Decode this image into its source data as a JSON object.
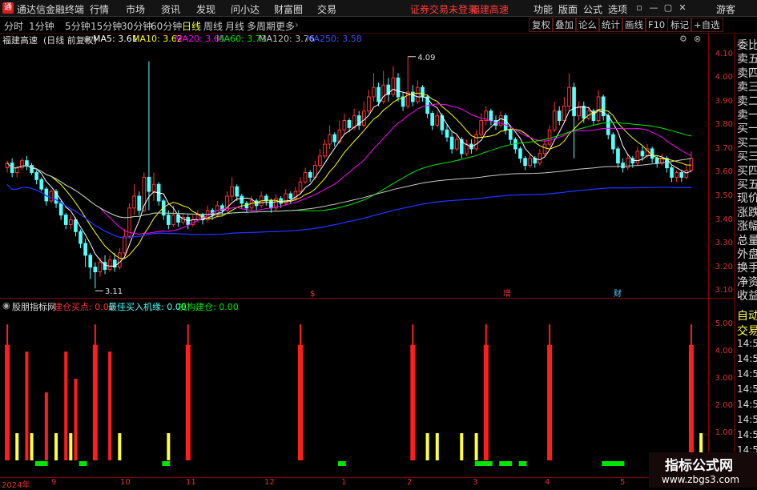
{
  "titlebar": {
    "app_name": "通达信金融终端",
    "menus": [
      "行情",
      "市场",
      "资讯",
      "发现",
      "问小达",
      "财富圈",
      "交易"
    ],
    "alert": "证券交易未登录",
    "alert_stock": "福建高速",
    "right_menus": [
      "功能",
      "版面",
      "公式",
      "选项"
    ],
    "user": "游客"
  },
  "periodbar": {
    "periods": [
      "分时",
      "1分钟",
      "5分钟",
      "15分钟",
      "30分钟",
      "60分钟",
      "日线",
      "周线",
      "月线",
      "多周期",
      "更多"
    ],
    "active": "日线",
    "tools": [
      "复权",
      "叠加",
      "论么",
      "统计",
      "画线",
      "F10",
      "标记",
      "+自选"
    ]
  },
  "infobar": {
    "stock": "福建高速",
    "mode": "(日线 前复权)",
    "ma5": "MA5: 3.61",
    "ma10": "MA10: 3.62",
    "ma20": "MA20: 3.65",
    "ma60": "MA60: 3.73",
    "ma120": "MA120: 3.76",
    "ma250": "MA250: 3.58"
  },
  "price_axis": [
    "4.10",
    "4.00",
    "3.90",
    "3.80",
    "3.70",
    "3.60",
    "3.50",
    "3.40",
    "3.30",
    "3.20",
    "3.10"
  ],
  "chart_marks": {
    "high": "4.09",
    "low": "3.11",
    "events": [
      "$",
      "增",
      "财"
    ]
  },
  "right_panel": [
    "委比",
    "卖五",
    "卖四",
    "卖三",
    "卖二",
    "卖一",
    "买一",
    "买二",
    "买三",
    "买四",
    "买五",
    "现价",
    "涨跌",
    "涨幅",
    "总量",
    "外盘",
    "换手",
    "净资",
    "收益"
  ],
  "right_panel_lower": [
    "自动",
    "交易",
    "14:56",
    "14:56",
    "14:56",
    "14:56",
    "14:56",
    "14:56",
    "14:56",
    "14:56"
  ],
  "indicator": {
    "name": "股朋指标网",
    "l1": "建仓买点: 0.00",
    "l2": "最佳买入机缘: 0.00",
    "l3": "机构建仓: 0.00",
    "axis": [
      "5.00",
      "4.00",
      "3.00",
      "2.00",
      "1.00"
    ]
  },
  "date_axis": [
    "2024年",
    "9",
    "10",
    "11",
    "12",
    "1",
    "2",
    "3",
    "4",
    "5"
  ],
  "watermark": {
    "title": "指标公式网",
    "url": "www.zbgs3.com"
  },
  "colors": {
    "up": "#ff3232",
    "down": "#54ffff",
    "ma5": "#ffffff",
    "ma10": "#ffff00",
    "ma20": "#ff00ff",
    "ma60": "#00e600",
    "ma120": "#c8c8c8",
    "ma250": "#1e32ff"
  },
  "chart_data": {
    "type": "candlestick",
    "ylim": [
      3.07,
      4.14
    ],
    "candles": [
      [
        3.62,
        3.64,
        3.6,
        3.65
      ],
      [
        3.64,
        3.6,
        3.58,
        3.66
      ],
      [
        3.6,
        3.62,
        3.58,
        3.63
      ],
      [
        3.62,
        3.65,
        3.61,
        3.66
      ],
      [
        3.65,
        3.63,
        3.61,
        3.67
      ],
      [
        3.63,
        3.6,
        3.59,
        3.64
      ],
      [
        3.6,
        3.57,
        3.55,
        3.61
      ],
      [
        3.57,
        3.53,
        3.52,
        3.58
      ],
      [
        3.53,
        3.48,
        3.46,
        3.54
      ],
      [
        3.48,
        3.52,
        3.47,
        3.53
      ],
      [
        3.52,
        3.47,
        3.45,
        3.53
      ],
      [
        3.47,
        3.42,
        3.4,
        3.48
      ],
      [
        3.42,
        3.38,
        3.36,
        3.43
      ],
      [
        3.38,
        3.4,
        3.36,
        3.42
      ],
      [
        3.4,
        3.35,
        3.33,
        3.41
      ],
      [
        3.35,
        3.3,
        3.28,
        3.36
      ],
      [
        3.3,
        3.25,
        3.2,
        3.32
      ],
      [
        3.25,
        3.2,
        3.15,
        3.26
      ],
      [
        3.2,
        3.18,
        3.11,
        3.22
      ],
      [
        3.18,
        3.22,
        3.16,
        3.24
      ],
      [
        3.22,
        3.19,
        3.17,
        3.25
      ],
      [
        3.19,
        3.23,
        3.18,
        3.25
      ],
      [
        3.23,
        3.2,
        3.18,
        3.26
      ],
      [
        3.2,
        3.26,
        3.19,
        3.28
      ],
      [
        3.26,
        3.33,
        3.25,
        3.36
      ],
      [
        3.33,
        3.45,
        3.32,
        3.47
      ],
      [
        3.45,
        3.5,
        3.42,
        3.55
      ],
      [
        3.5,
        3.44,
        3.42,
        3.52
      ],
      [
        3.44,
        3.58,
        3.43,
        3.6
      ],
      [
        3.58,
        3.52,
        3.44,
        4.07
      ],
      [
        3.52,
        3.55,
        3.48,
        3.6
      ],
      [
        3.55,
        3.48,
        3.46,
        3.56
      ],
      [
        3.48,
        3.42,
        3.4,
        3.49
      ],
      [
        3.42,
        3.38,
        3.36,
        3.44
      ],
      [
        3.38,
        3.42,
        3.37,
        3.46
      ],
      [
        3.42,
        3.39,
        3.37,
        3.44
      ],
      [
        3.39,
        3.41,
        3.38,
        3.43
      ],
      [
        3.41,
        3.38,
        3.36,
        3.42
      ],
      [
        3.38,
        3.4,
        3.37,
        3.42
      ],
      [
        3.4,
        3.42,
        3.39,
        3.44
      ],
      [
        3.42,
        3.4,
        3.38,
        3.43
      ],
      [
        3.4,
        3.44,
        3.39,
        3.46
      ],
      [
        3.44,
        3.42,
        3.4,
        3.45
      ],
      [
        3.42,
        3.46,
        3.41,
        3.48
      ],
      [
        3.46,
        3.44,
        3.42,
        3.47
      ],
      [
        3.44,
        3.5,
        3.43,
        3.52
      ],
      [
        3.5,
        3.54,
        3.48,
        3.58
      ],
      [
        3.54,
        3.5,
        3.48,
        3.55
      ],
      [
        3.5,
        3.47,
        3.45,
        3.51
      ],
      [
        3.47,
        3.45,
        3.43,
        3.48
      ],
      [
        3.45,
        3.48,
        3.44,
        3.5
      ],
      [
        3.48,
        3.46,
        3.44,
        3.49
      ],
      [
        3.46,
        3.5,
        3.45,
        3.52
      ],
      [
        3.5,
        3.48,
        3.46,
        3.51
      ],
      [
        3.48,
        3.45,
        3.43,
        3.49
      ],
      [
        3.45,
        3.49,
        3.44,
        3.51
      ],
      [
        3.49,
        3.47,
        3.45,
        3.5
      ],
      [
        3.47,
        3.51,
        3.46,
        3.53
      ],
      [
        3.51,
        3.49,
        3.47,
        3.52
      ],
      [
        3.49,
        3.52,
        3.48,
        3.54
      ],
      [
        3.52,
        3.56,
        3.51,
        3.58
      ],
      [
        3.56,
        3.6,
        3.55,
        3.62
      ],
      [
        3.6,
        3.58,
        3.56,
        3.61
      ],
      [
        3.58,
        3.63,
        3.57,
        3.65
      ],
      [
        3.63,
        3.67,
        3.62,
        3.7
      ],
      [
        3.67,
        3.72,
        3.66,
        3.74
      ],
      [
        3.72,
        3.76,
        3.7,
        3.8
      ],
      [
        3.76,
        3.73,
        3.71,
        3.77
      ],
      [
        3.73,
        3.78,
        3.72,
        3.82
      ],
      [
        3.78,
        3.82,
        3.76,
        3.85
      ],
      [
        3.82,
        3.79,
        3.77,
        3.83
      ],
      [
        3.79,
        3.84,
        3.78,
        3.87
      ],
      [
        3.84,
        3.8,
        3.78,
        3.86
      ],
      [
        3.8,
        3.86,
        3.79,
        3.9
      ],
      [
        3.86,
        3.92,
        3.85,
        3.95
      ],
      [
        3.92,
        3.96,
        3.9,
        4.02
      ],
      [
        3.96,
        3.9,
        3.88,
        3.98
      ],
      [
        3.9,
        3.97,
        3.89,
        4.03
      ],
      [
        3.97,
        3.93,
        3.9,
        4.0
      ],
      [
        3.93,
        4.0,
        3.92,
        4.05
      ],
      [
        4.0,
        3.92,
        3.9,
        4.02
      ],
      [
        3.92,
        3.88,
        3.86,
        3.94
      ],
      [
        3.88,
        3.94,
        3.87,
        4.09
      ],
      [
        3.94,
        3.9,
        3.88,
        3.97
      ],
      [
        3.9,
        3.96,
        3.89,
        3.99
      ],
      [
        3.96,
        3.92,
        3.9,
        3.97
      ],
      [
        3.92,
        3.85,
        3.83,
        3.93
      ],
      [
        3.85,
        3.8,
        3.78,
        3.86
      ],
      [
        3.8,
        3.84,
        3.79,
        3.86
      ],
      [
        3.84,
        3.78,
        3.76,
        3.85
      ],
      [
        3.78,
        3.75,
        3.73,
        3.8
      ],
      [
        3.75,
        3.7,
        3.68,
        3.77
      ],
      [
        3.7,
        3.74,
        3.69,
        3.76
      ],
      [
        3.74,
        3.68,
        3.66,
        3.75
      ],
      [
        3.68,
        3.72,
        3.67,
        3.74
      ],
      [
        3.72,
        3.7,
        3.68,
        3.74
      ],
      [
        3.7,
        3.76,
        3.69,
        3.78
      ],
      [
        3.76,
        3.82,
        3.75,
        3.85
      ],
      [
        3.82,
        3.86,
        3.8,
        3.88
      ],
      [
        3.86,
        3.82,
        3.8,
        3.87
      ],
      [
        3.82,
        3.8,
        3.78,
        3.84
      ],
      [
        3.8,
        3.84,
        3.79,
        3.86
      ],
      [
        3.84,
        3.78,
        3.76,
        3.85
      ],
      [
        3.78,
        3.74,
        3.72,
        3.8
      ],
      [
        3.74,
        3.7,
        3.68,
        3.75
      ],
      [
        3.7,
        3.66,
        3.64,
        3.71
      ],
      [
        3.66,
        3.63,
        3.61,
        3.67
      ],
      [
        3.63,
        3.66,
        3.62,
        3.68
      ],
      [
        3.66,
        3.64,
        3.62,
        3.67
      ],
      [
        3.64,
        3.68,
        3.63,
        3.7
      ],
      [
        3.68,
        3.72,
        3.67,
        3.74
      ],
      [
        3.72,
        3.78,
        3.71,
        3.8
      ],
      [
        3.78,
        3.86,
        3.77,
        3.9
      ],
      [
        3.86,
        3.82,
        3.8,
        3.88
      ],
      [
        3.82,
        3.88,
        3.81,
        3.92
      ],
      [
        3.88,
        3.96,
        3.86,
        4.02
      ],
      [
        3.96,
        3.84,
        3.66,
        3.98
      ],
      [
        3.84,
        3.88,
        3.82,
        3.9
      ],
      [
        3.88,
        3.83,
        3.81,
        3.9
      ],
      [
        3.83,
        3.86,
        3.82,
        3.88
      ],
      [
        3.86,
        3.82,
        3.8,
        3.87
      ],
      [
        3.82,
        3.92,
        3.81,
        3.95
      ],
      [
        3.92,
        3.84,
        3.82,
        3.93
      ],
      [
        3.84,
        3.76,
        3.74,
        3.85
      ],
      [
        3.76,
        3.7,
        3.68,
        3.77
      ],
      [
        3.7,
        3.64,
        3.62,
        3.71
      ],
      [
        3.64,
        3.62,
        3.6,
        3.66
      ],
      [
        3.62,
        3.66,
        3.61,
        3.68
      ],
      [
        3.66,
        3.64,
        3.62,
        3.67
      ],
      [
        3.64,
        3.69,
        3.63,
        3.71
      ],
      [
        3.69,
        3.67,
        3.65,
        3.71
      ],
      [
        3.67,
        3.7,
        3.66,
        3.72
      ],
      [
        3.7,
        3.66,
        3.64,
        3.71
      ],
      [
        3.66,
        3.64,
        3.62,
        3.67
      ],
      [
        3.64,
        3.66,
        3.63,
        3.68
      ],
      [
        3.66,
        3.62,
        3.6,
        3.67
      ],
      [
        3.62,
        3.58,
        3.56,
        3.63
      ],
      [
        3.58,
        3.6,
        3.56,
        3.61
      ],
      [
        3.6,
        3.58,
        3.56,
        3.61
      ],
      [
        3.58,
        3.61,
        3.57,
        3.63
      ],
      [
        3.61,
        3.66,
        3.6,
        3.69
      ]
    ],
    "ind_values": [
      [
        0,
        5
      ],
      [
        2,
        1
      ],
      [
        4,
        4
      ],
      [
        5,
        1
      ],
      [
        8,
        2.5
      ],
      [
        10,
        1
      ],
      [
        12,
        4
      ],
      [
        13,
        1
      ],
      [
        14,
        3
      ],
      [
        18,
        5
      ],
      [
        21,
        4
      ],
      [
        23,
        1
      ],
      [
        33,
        1
      ],
      [
        37,
        5
      ],
      [
        60,
        5
      ],
      [
        83,
        5
      ],
      [
        86,
        1
      ],
      [
        88,
        1
      ],
      [
        93,
        1
      ],
      [
        96,
        1
      ],
      [
        98,
        5
      ],
      [
        111,
        5
      ],
      [
        140,
        5
      ],
      [
        142,
        1
      ],
      [
        148,
        5
      ],
      [
        150,
        1
      ],
      [
        155,
        5
      ]
    ],
    "ind_green": [
      [
        6,
        8
      ],
      [
        15,
        16
      ],
      [
        32,
        33
      ],
      [
        68,
        69
      ],
      [
        96,
        99
      ],
      [
        101,
        103
      ],
      [
        105,
        106
      ],
      [
        122,
        126
      ],
      [
        132,
        137
      ],
      [
        149,
        150
      ],
      [
        153,
        154
      ]
    ]
  }
}
